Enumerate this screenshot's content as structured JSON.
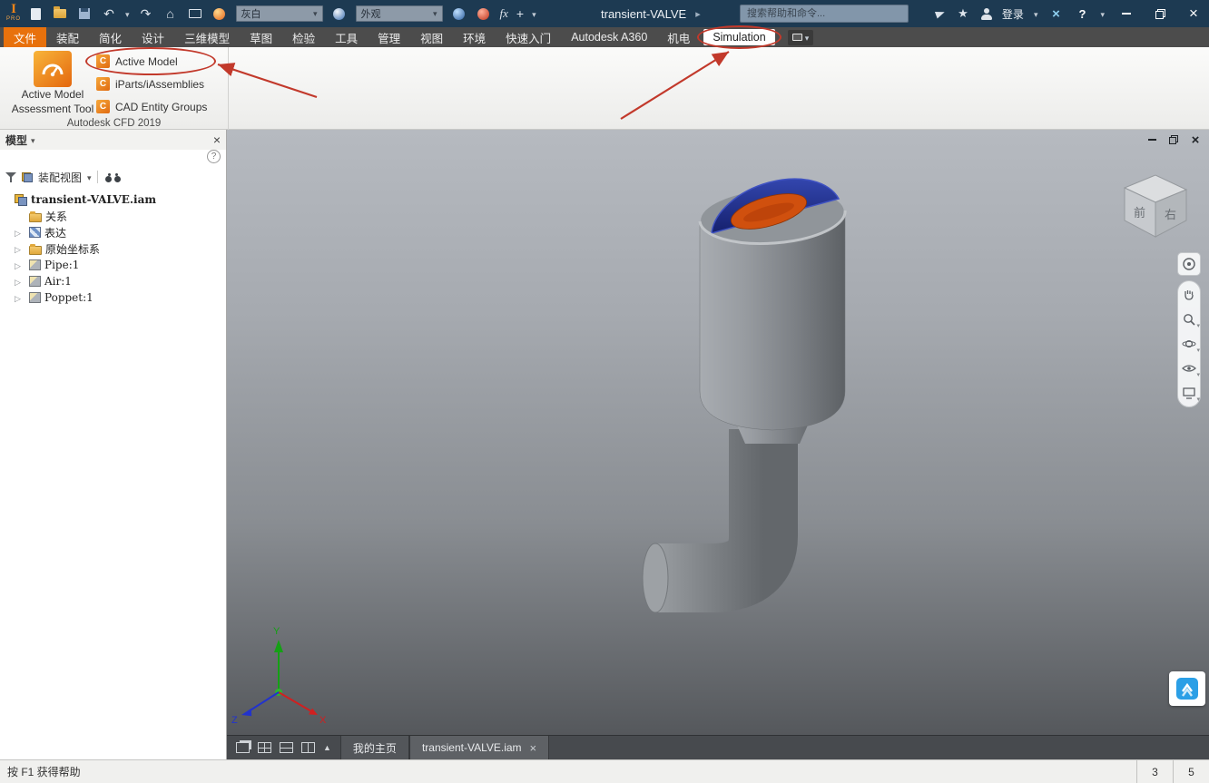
{
  "titlebar": {
    "pro": "PRO",
    "doc_title": "transient-VALVE",
    "search_placeholder": "搜索帮助和命令...",
    "sign_in": "登录",
    "material_value": "灰白",
    "appearance_value": "外观",
    "fx": "fx"
  },
  "ribbon": {
    "tabs": [
      "文件",
      "装配",
      "简化",
      "设计",
      "三维模型",
      "草图",
      "检验",
      "工具",
      "管理",
      "视图",
      "环境",
      "快速入门",
      "Autodesk A360",
      "机电",
      "Simulation"
    ],
    "panel": {
      "tool_line1": "Active Model",
      "tool_line2": "Assessment Tool",
      "items": [
        "Active Model",
        "iParts/iAssemblies",
        "CAD Entity Groups"
      ],
      "footer": "Autodesk CFD 2019"
    }
  },
  "browser": {
    "title": "模型",
    "view_mode": "装配视图",
    "tree": [
      {
        "label": "transient-VALVE.iam",
        "type": "assembly"
      },
      {
        "label": "关系",
        "type": "folder"
      },
      {
        "label": "表达",
        "type": "representations"
      },
      {
        "label": "原始坐标系",
        "type": "folder"
      },
      {
        "label": "Pipe:1",
        "type": "part"
      },
      {
        "label": "Air:1",
        "type": "part"
      },
      {
        "label": "Poppet:1",
        "type": "part"
      }
    ]
  },
  "viewport": {
    "tabs": [
      "我的主页",
      "transient-VALVE.iam"
    ],
    "viewcube": {
      "front": "前",
      "right": "右"
    },
    "axes": {
      "x": "X",
      "y": "Y",
      "z": "Z"
    }
  },
  "statusbar": {
    "hint": "按 F1 获得帮助",
    "n1": "3",
    "n2": "5"
  },
  "colors": {
    "accent": "#e8710c",
    "annotation": "#c2392b",
    "air_blue": "#1f2d8e",
    "poppet_orange": "#d35413"
  }
}
